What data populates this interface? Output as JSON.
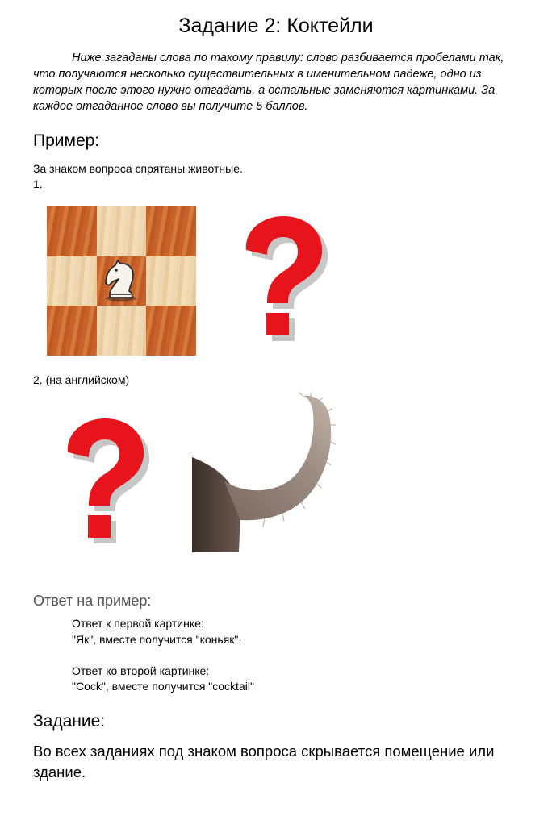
{
  "page_title": "Задание 2: Коктейли",
  "intro": "Ниже загаданы слова по такому правилу: слово разбивается пробелами так, что получаются несколько существительных в именительном падеже, одно из которых после этого нужно отгадать, а остальные заменяются картинками. За каждое отгаданное слово вы получите 5 баллов.",
  "example": {
    "heading": "Пример:",
    "hint": "За знаком вопроса спрятаны животные.",
    "item1_label": "1.",
    "item2_label": "2. (на английском)"
  },
  "images": {
    "chessboard": "chessboard-knight",
    "question": "question-mark-icon",
    "tail": "cat-tail"
  },
  "answer": {
    "heading": "Ответ на пример:",
    "first_title": "Ответ к первой картинке:",
    "first_text": "\"Як\", вместе получится \"коньяк\".",
    "second_title": "Ответ ко второй картинке:",
    "second_text": "\"Cock\", вместе получится \"cocktail\""
  },
  "task": {
    "heading": "Задание:",
    "text": "Во всех заданиях под знаком вопроса скрывается помещение или здание."
  },
  "colors": {
    "question_red": "#e8141b",
    "answer_heading": "#555555"
  }
}
